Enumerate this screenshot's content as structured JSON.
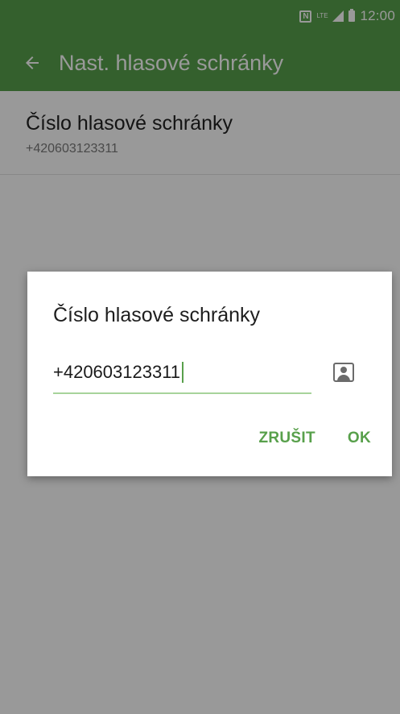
{
  "colors": {
    "accent": "#58a04b",
    "appbar": "#58a04b",
    "scrim": "rgba(0,0,0,0.40)"
  },
  "statusbar": {
    "icons": [
      "nfc-icon",
      "lte-icon",
      "signal-icon",
      "battery-icon"
    ],
    "nfc_label": "N",
    "lte_label": "LTE",
    "time": "12:00"
  },
  "toolbar": {
    "back_icon": "arrow-left-icon",
    "title": "Nast. hlasové schránky"
  },
  "setting": {
    "title": "Číslo hlasové schránky",
    "value": "+420603123311"
  },
  "dialog": {
    "title": "Číslo hlasové schránky",
    "input_value": "+420603123311",
    "contact_icon": "contact-picker-icon",
    "cancel_label": "ZRUŠIT",
    "ok_label": "OK"
  }
}
